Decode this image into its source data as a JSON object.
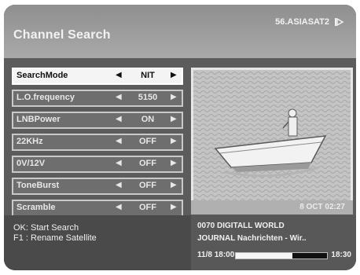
{
  "header": {
    "title": "Channel Search",
    "satellite": "56.ASIASAT2",
    "icon": "satellite-dish-icon"
  },
  "menu": {
    "items": [
      {
        "label": "SearchMode",
        "value": "NIT",
        "active": true
      },
      {
        "label": "L.O.frequency",
        "value": "5150"
      },
      {
        "label": "LNBPower",
        "value": "ON"
      },
      {
        "label": "22KHz",
        "value": "OFF"
      },
      {
        "label": "0V/12V",
        "value": "OFF"
      },
      {
        "label": "ToneBurst",
        "value": "OFF"
      },
      {
        "label": "Scramble",
        "value": "OFF"
      }
    ],
    "arrow_left": "◀",
    "arrow_right": "▶"
  },
  "preview": {
    "date": "8 OCT 02:27"
  },
  "help": {
    "line1": "OK: Start Search",
    "line2": "F1 : Rename Satellite"
  },
  "info": {
    "channel": "0070 DIGITALL WORLD",
    "program": "JOURNAL Nachrichten - Wir..",
    "start": "11/8 18:00",
    "end": "18:30",
    "progress": 0.62
  }
}
